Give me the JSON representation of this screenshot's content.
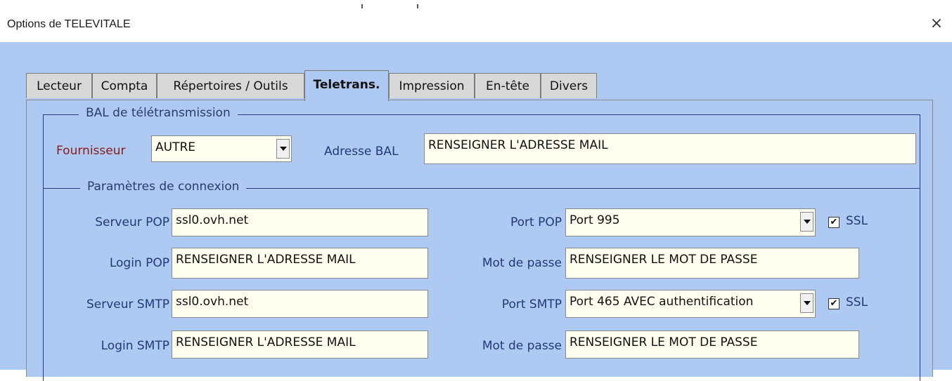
{
  "window": {
    "title": "Options de TELEVITALE",
    "close_glyph": "×"
  },
  "tabs": [
    {
      "label": "Lecteur"
    },
    {
      "label": "Compta"
    },
    {
      "label": "Répertoires / Outils"
    },
    {
      "label": "Teletrans."
    },
    {
      "label": "Impression"
    },
    {
      "label": "En-tête"
    },
    {
      "label": "Divers"
    }
  ],
  "bal": {
    "legend": "BAL de télétransmission",
    "provider_label": "Fournisseur",
    "provider_value": "AUTRE",
    "address_label": "Adresse BAL",
    "address_value": "RENSEIGNER L'ADRESSE MAIL"
  },
  "connection": {
    "legend": "Paramètres de connexion",
    "pop_server_label": "Serveur POP",
    "pop_server_value": "ssl0.ovh.net",
    "pop_login_label": "Login POP",
    "pop_login_value": "RENSEIGNER L'ADRESSE MAIL",
    "smtp_server_label": "Serveur SMTP",
    "smtp_server_value": "ssl0.ovh.net",
    "smtp_login_label": "Login SMTP",
    "smtp_login_value": "RENSEIGNER L'ADRESSE MAIL",
    "pop_port_label": "Port POP",
    "pop_port_value": "Port 995",
    "pop_password_label": "Mot de passe",
    "pop_password_value": "RENSEIGNER LE MOT DE PASSE",
    "smtp_port_label": "Port SMTP",
    "smtp_port_value": "Port 465 AVEC authentification",
    "smtp_password_label": "Mot de passe",
    "smtp_password_value": "RENSEIGNER LE MOT DE PASSE",
    "ssl_label": "SSL",
    "ssl_check_glyph": "✔",
    "pop_ssl_checked": true,
    "smtp_ssl_checked": true
  },
  "colors": {
    "background": "#aecaf2",
    "field_bg": "#fffff0",
    "label_blue": "#1f3a78",
    "label_red": "#8b1a1a",
    "frame_border": "#2b3a86"
  }
}
